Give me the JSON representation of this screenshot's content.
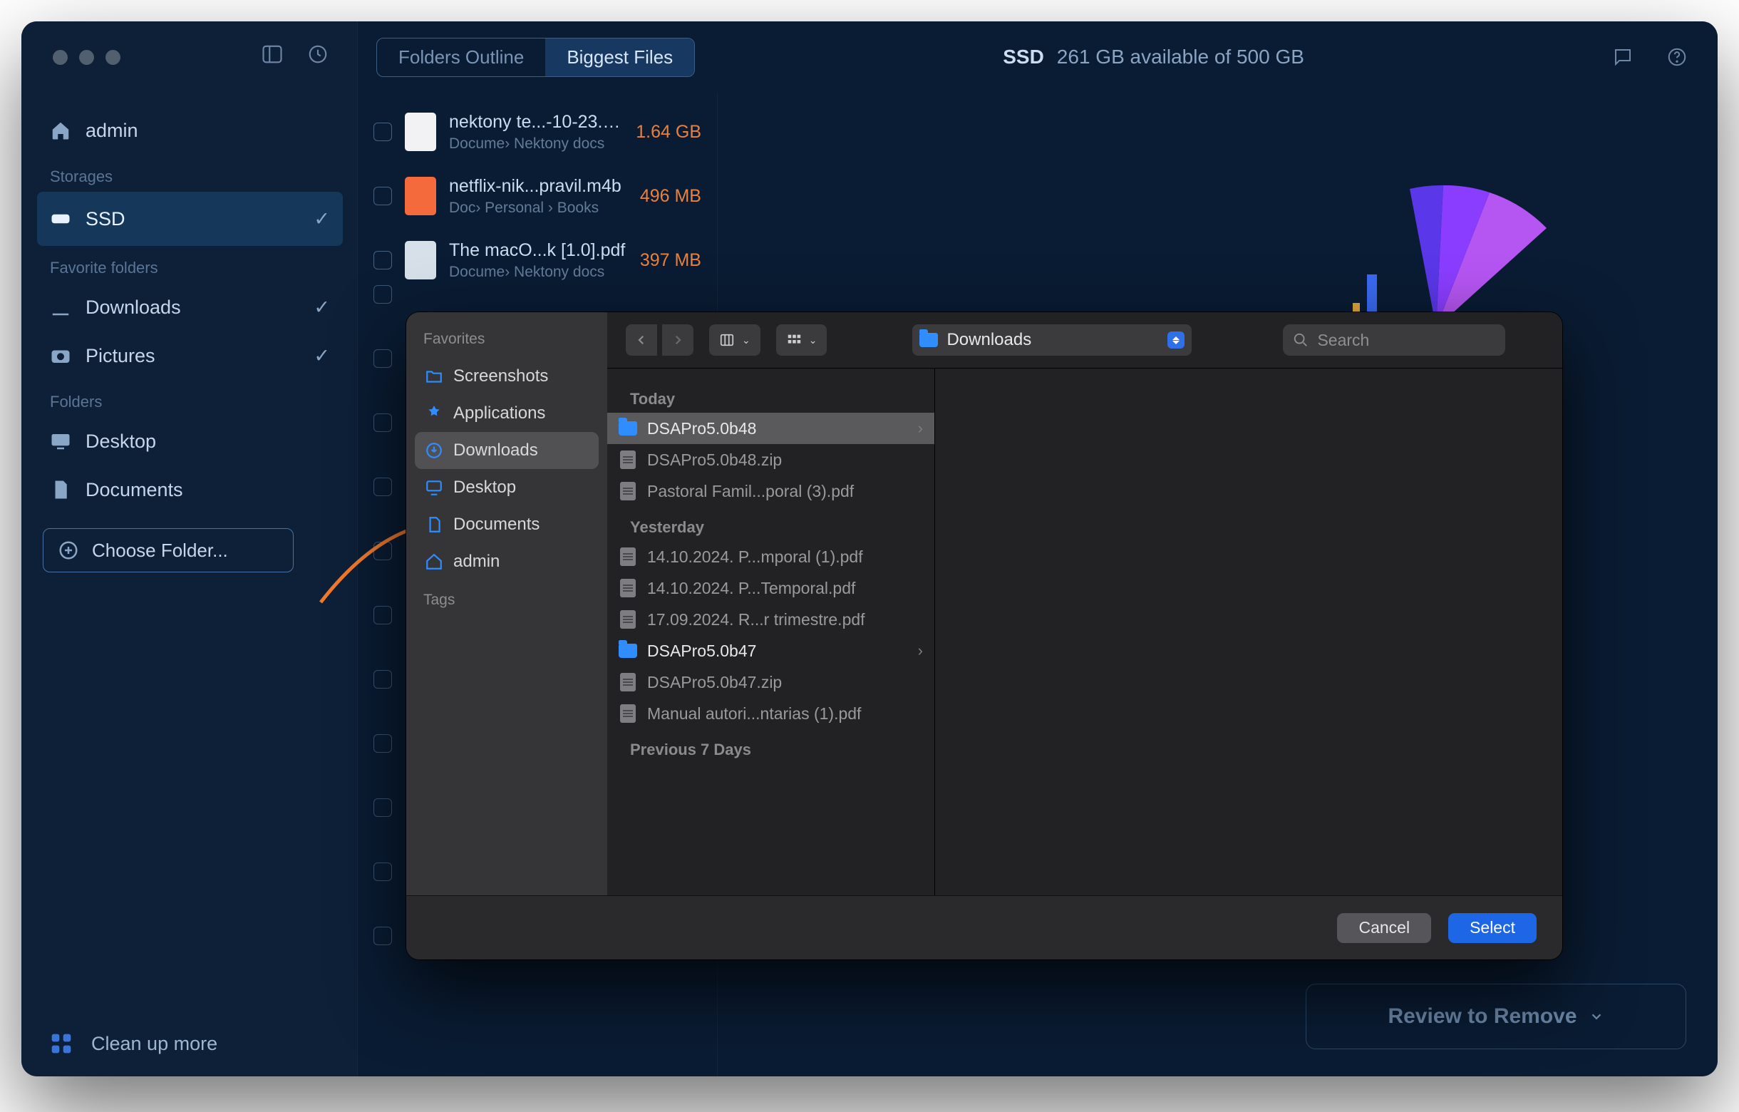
{
  "header": {
    "drive": "SSD",
    "available": "261 GB available of 500 GB"
  },
  "segments": {
    "left": "Folders Outline",
    "right": "Biggest Files"
  },
  "sidebar": {
    "home": "admin",
    "section_storages": "Storages",
    "storage_items": [
      {
        "label": "SSD"
      }
    ],
    "section_fav": "Favorite folders",
    "fav_items": [
      {
        "label": "Downloads"
      },
      {
        "label": "Pictures"
      }
    ],
    "section_folders": "Folders",
    "folder_items": [
      {
        "label": "Desktop"
      },
      {
        "label": "Documents"
      }
    ],
    "choose": "Choose Folder...",
    "footer": "Clean up more"
  },
  "biggest_files": [
    {
      "name": "nektony te...-10-23.zip",
      "path": "Docume› Nektony docs",
      "size": "1.64 GB",
      "type": "zip"
    },
    {
      "name": "netflix-nik...pravil.m4b",
      "path": "Doc› Personal › Books",
      "size": "496 MB",
      "type": "vid"
    },
    {
      "name": "The macO...k [1.0].pdf",
      "path": "Docume› Nektony docs",
      "size": "397 MB",
      "type": "pdf"
    }
  ],
  "review_btn": "Review to Remove",
  "dialog": {
    "labels": {
      "favorites": "Favorites",
      "tags": "Tags"
    },
    "fav": [
      {
        "label": "Screenshots",
        "icon": "folder"
      },
      {
        "label": "Applications",
        "icon": "apps"
      },
      {
        "label": "Downloads",
        "icon": "download",
        "selected": true
      },
      {
        "label": "Desktop",
        "icon": "desktop"
      },
      {
        "label": "Documents",
        "icon": "doc"
      },
      {
        "label": "admin",
        "icon": "home"
      }
    ],
    "location": "Downloads",
    "search_placeholder": "Search",
    "groups": [
      {
        "title": "Today",
        "entries": [
          {
            "name": "DSAPro5.0b48",
            "type": "folder",
            "sel": "strong"
          },
          {
            "name": "DSAPro5.0b48.zip",
            "type": "file"
          },
          {
            "name": "Pastoral Famil...poral (3).pdf",
            "type": "file"
          }
        ]
      },
      {
        "title": "Yesterday",
        "entries": [
          {
            "name": "14.10.2024. P...mporal (1).pdf",
            "type": "file"
          },
          {
            "name": "14.10.2024. P...Temporal.pdf",
            "type": "file"
          },
          {
            "name": "17.09.2024. R...r trimestre.pdf",
            "type": "file"
          },
          {
            "name": "DSAPro5.0b47",
            "type": "folder",
            "sel": "weak"
          },
          {
            "name": "DSAPro5.0b47.zip",
            "type": "file"
          },
          {
            "name": "Manual autori...ntarias (1).pdf",
            "type": "file"
          }
        ]
      },
      {
        "title": "Previous 7 Days",
        "entries": []
      }
    ],
    "buttons": {
      "cancel": "Cancel",
      "select": "Select"
    }
  }
}
